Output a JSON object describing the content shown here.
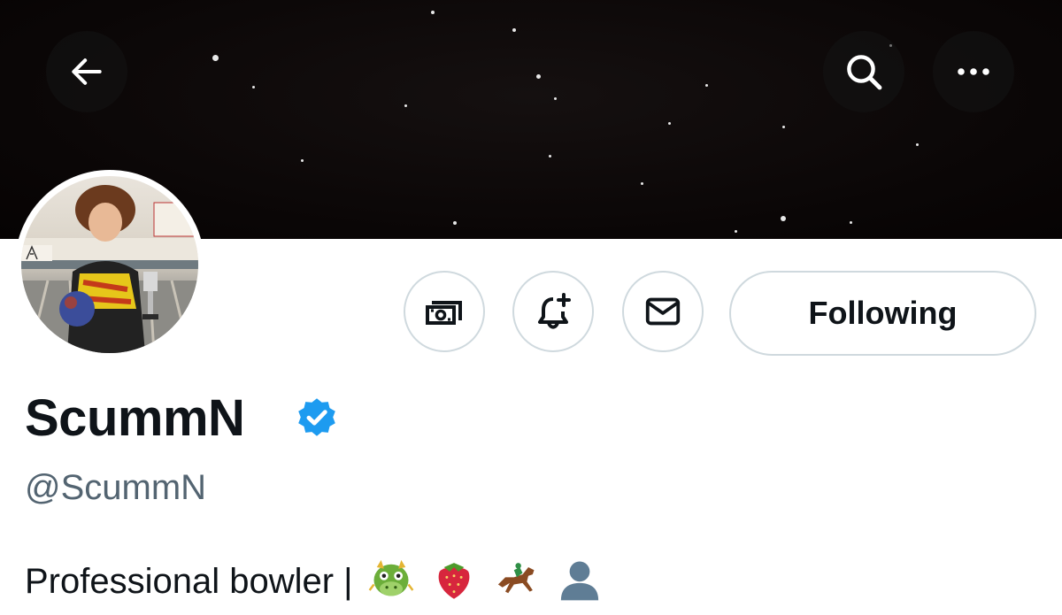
{
  "header": {
    "back_icon": "arrow-left-icon",
    "search_icon": "search-icon",
    "more_icon": "more-horizontal-icon"
  },
  "profile": {
    "display_name": "ScummN",
    "verified": true,
    "handle": "@ScummN",
    "bio_text": "Professional bowler |",
    "bio_emojis": [
      "dragon-face-emoji",
      "strawberry-emoji",
      "horse-racing-emoji",
      "bust-silhouette-emoji"
    ]
  },
  "actions": {
    "tip_icon": "money-tip-icon",
    "notify_icon": "bell-plus-icon",
    "message_icon": "envelope-icon",
    "following_label": "Following"
  },
  "colors": {
    "verified_blue": "#1d9bf0",
    "text_primary": "#0f1419",
    "text_secondary": "#536471",
    "border": "#cfd9de",
    "banner": "#0a0606"
  }
}
